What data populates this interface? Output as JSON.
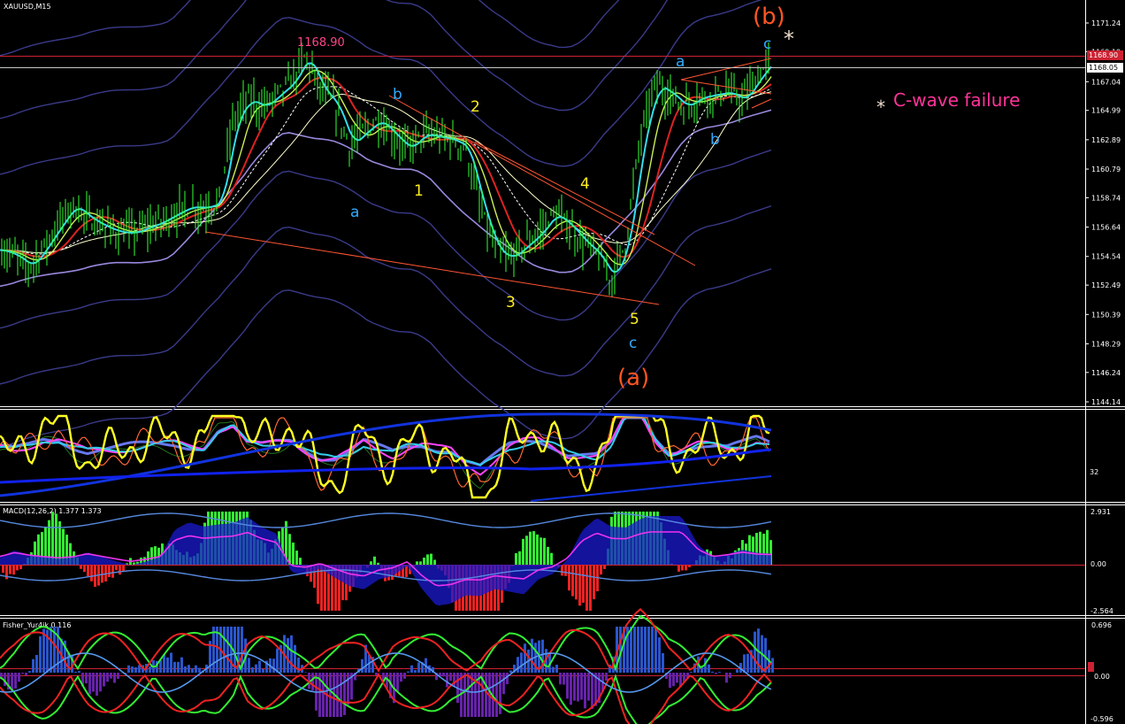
{
  "colors": {
    "background": "#000000",
    "grid": "#ffffff",
    "candle": "#33ff33",
    "fib_line": "#ff5533",
    "wave_yellow": "#ffee22",
    "wave_blue": "#33aaff",
    "wave_orange": "#ff5522",
    "note": "#ff3399",
    "price_line": "#cc2233",
    "bid_line": "#dddddd"
  },
  "panels": {
    "main": {
      "symbol": "XAUUSD,M15",
      "price_axis": [
        "1171.24",
        "1169.19",
        "1167.04",
        "1164.99",
        "1162.89",
        "1160.79",
        "1158.74",
        "1156.64",
        "1154.54",
        "1152.49",
        "1150.39",
        "1148.29",
        "1146.24",
        "1144.14"
      ],
      "current_price": "1168.05",
      "upper_price": "1168.90",
      "high_label": "1168.90",
      "note": "C-wave failure",
      "note_star": "*",
      "b_star": "*"
    },
    "stoch": {
      "axis_label": "32"
    },
    "macd": {
      "title": "MACD(12,26,2) 1.377 1.373",
      "axis": [
        "2.931",
        "0.00",
        "-2.564"
      ]
    },
    "fisher": {
      "title": "Fisher_Yur4ik 0.116",
      "axis": [
        "0.696",
        "0.00",
        "-0.596"
      ],
      "mid_mark": "0.1"
    }
  },
  "waves": [
    {
      "text": "a",
      "color": "blue",
      "at": "first low"
    },
    {
      "text": "b",
      "color": "blue",
      "at": "downtrend start"
    },
    {
      "text": "1",
      "color": "yellow"
    },
    {
      "text": "2",
      "color": "yellow"
    },
    {
      "text": "3",
      "color": "yellow"
    },
    {
      "text": "4",
      "color": "yellow"
    },
    {
      "text": "5",
      "color": "yellow"
    },
    {
      "text": "c",
      "color": "blue",
      "at": "wave (a) end"
    },
    {
      "text": "(a)",
      "color": "orange"
    },
    {
      "text": "a",
      "color": "blue",
      "at": "rally top"
    },
    {
      "text": "b",
      "color": "blue",
      "at": "consolidation"
    },
    {
      "text": "c",
      "color": "blue",
      "at": "final high"
    },
    {
      "text": "(b)",
      "color": "orange"
    }
  ],
  "chart_data": {
    "type": "line",
    "instrument": "XAUUSD",
    "timeframe": "M15",
    "y_axis": {
      "min": 1144.14,
      "max": 1171.24
    },
    "series": [
      {
        "values": [
          1155.0,
          1154.6,
          1153.8,
          1155.2,
          1156.8,
          1158.2,
          1157.3,
          1156.7,
          1156.3,
          1156.2,
          1156.6,
          1157.0,
          1157.6,
          1158.1,
          1158.0,
          1158.4,
          1164.2,
          1165.8,
          1165.2,
          1166.1,
          1167.0,
          1168.9,
          1166.5,
          1165.4,
          1162.5,
          1163.5,
          1164.3,
          1163.2,
          1162.2,
          1163.3,
          1163.1,
          1162.9,
          1162.3,
          1158.0,
          1155.0,
          1154.4,
          1155.3,
          1156.2,
          1157.6,
          1156.8,
          1155.6,
          1154.7,
          1152.9,
          1155.6,
          1163.0,
          1166.8,
          1166.2,
          1165.2,
          1165.9,
          1166.1,
          1166.3,
          1165.7,
          1167.3,
          1168.6
        ]
      }
    ],
    "macd": {
      "name": "MACD(12,26,2)",
      "main": 1.377,
      "signal": 1.373,
      "ylim": [
        -2.564,
        2.931
      ]
    },
    "fisher": {
      "name": "Fisher_Yur4ik",
      "value": 0.116,
      "ylim": [
        -0.596,
        0.696
      ]
    }
  }
}
